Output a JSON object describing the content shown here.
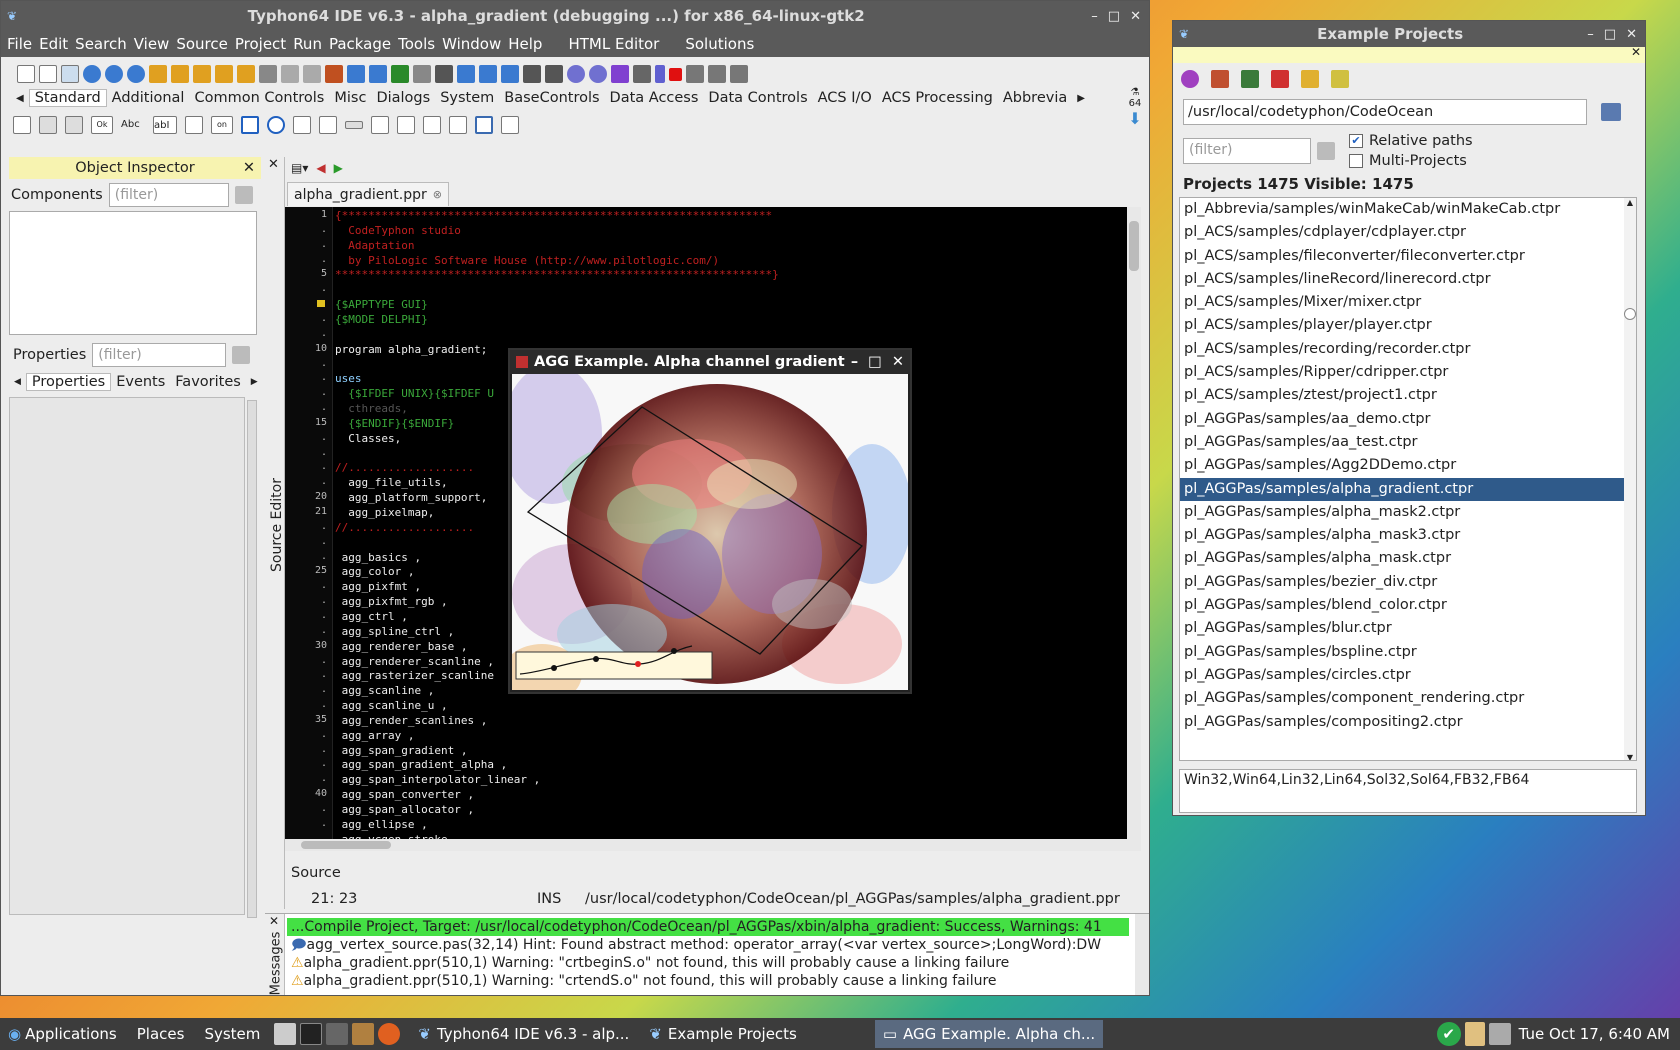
{
  "ide": {
    "title": "Typhon64 IDE v6.3 - alpha_gradient (debugging ...) for x86_64-linux-gtk2",
    "menu": [
      "File",
      "Edit",
      "Search",
      "View",
      "Source",
      "Project",
      "Run",
      "Package",
      "Tools",
      "Window",
      "Help",
      "HTML Editor",
      "Solutions"
    ],
    "palette_tabs": [
      "Standard",
      "Additional",
      "Common Controls",
      "Misc",
      "Dialogs",
      "System",
      "BaseControls",
      "Data Access",
      "Data Controls",
      "ACS I/O",
      "ACS Processing",
      "Abbrevia"
    ],
    "palette_badge": "64"
  },
  "inspector": {
    "title": "Object Inspector",
    "components_label": "Components",
    "filter_placeholder": "(filter)",
    "properties_label": "Properties",
    "tabs": [
      "Properties",
      "Events",
      "Favorites"
    ]
  },
  "editor": {
    "vertical_label": "Source Editor",
    "file_tab": "alpha_gradient.ppr",
    "lines": [
      {
        "n": "1",
        "t": "{*****************************************************************",
        "c": "#c02020"
      },
      {
        "n": ".",
        "t": "  CodeTyphon studio",
        "c": "#c02020"
      },
      {
        "n": ".",
        "t": "  Adaptation",
        "c": "#c02020"
      },
      {
        "n": ".",
        "t": "  by PiloLogic Software House (http://www.pilotlogic.com/)",
        "c": "#c02020"
      },
      {
        "n": "5",
        "t": "******************************************************************}",
        "c": "#c02020"
      },
      {
        "n": ".",
        "t": "",
        "c": "#eee"
      },
      {
        "n": ".",
        "t": "{$APPTYPE GUI}",
        "c": "#3aa83a"
      },
      {
        "n": ".",
        "t": "{$MODE DELPHI}",
        "c": "#3aa83a"
      },
      {
        "n": ".",
        "t": "",
        "c": "#eee"
      },
      {
        "n": "10",
        "t": "program alpha_gradient;",
        "c": "#eee"
      },
      {
        "n": ".",
        "t": "",
        "c": "#eee"
      },
      {
        "n": ".",
        "t": "uses",
        "c": "#8fd0ff"
      },
      {
        "n": ".",
        "t": "  {$IFDEF UNIX}{$IFDEF U",
        "c": "#3aa83a"
      },
      {
        "n": ".",
        "t": "  cthreads,",
        "c": "#555"
      },
      {
        "n": "15",
        "t": "  {$ENDIF}{$ENDIF}",
        "c": "#3aa83a"
      },
      {
        "n": ".",
        "t": "  Classes,",
        "c": "#eee"
      },
      {
        "n": ".",
        "t": "",
        "c": "#eee"
      },
      {
        "n": ".",
        "t": "//...................",
        "c": "#c02020"
      },
      {
        "n": ".",
        "t": "  agg_file_utils,",
        "c": "#eee"
      },
      {
        "n": "20",
        "t": "  agg_platform_support,",
        "c": "#eee"
      },
      {
        "n": "21",
        "t": "  agg_pixelmap,",
        "c": "#eee"
      },
      {
        "n": ".",
        "t": "//...................",
        "c": "#c02020"
      },
      {
        "n": ".",
        "t": "",
        "c": "#eee"
      },
      {
        "n": ".",
        "t": " agg_basics ,",
        "c": "#eee"
      },
      {
        "n": "25",
        "t": " agg_color ,",
        "c": "#eee"
      },
      {
        "n": ".",
        "t": " agg_pixfmt ,",
        "c": "#eee"
      },
      {
        "n": ".",
        "t": " agg_pixfmt_rgb ,",
        "c": "#eee"
      },
      {
        "n": ".",
        "t": " agg_ctrl ,",
        "c": "#eee"
      },
      {
        "n": ".",
        "t": " agg_spline_ctrl ,",
        "c": "#eee"
      },
      {
        "n": "30",
        "t": " agg_renderer_base ,",
        "c": "#eee"
      },
      {
        "n": ".",
        "t": " agg_renderer_scanline ,",
        "c": "#eee"
      },
      {
        "n": ".",
        "t": " agg_rasterizer_scanline",
        "c": "#eee"
      },
      {
        "n": ".",
        "t": " agg_scanline ,",
        "c": "#eee"
      },
      {
        "n": ".",
        "t": " agg_scanline_u ,",
        "c": "#eee"
      },
      {
        "n": "35",
        "t": " agg_render_scanlines ,",
        "c": "#eee"
      },
      {
        "n": ".",
        "t": " agg_array ,",
        "c": "#eee"
      },
      {
        "n": ".",
        "t": " agg_span_gradient ,",
        "c": "#eee"
      },
      {
        "n": ".",
        "t": " agg_span_gradient_alpha ,",
        "c": "#eee"
      },
      {
        "n": ".",
        "t": " agg_span_interpolator_linear ,",
        "c": "#eee"
      },
      {
        "n": "40",
        "t": " agg_span_converter ,",
        "c": "#eee"
      },
      {
        "n": ".",
        "t": " agg_span_allocator ,",
        "c": "#eee"
      },
      {
        "n": ".",
        "t": " agg_ellipse ,",
        "c": "#eee"
      },
      {
        "n": ".",
        "t": " agg_vcgen_stroke ,",
        "c": "#eee"
      }
    ],
    "source_tab": "Source",
    "status_pos": "21: 23",
    "status_mode": "INS",
    "status_path": "/usr/local/codetyphon/CodeOcean/pl_AGGPas/samples/alpha_gradient.ppr"
  },
  "messages": {
    "vertical_label": "Messages",
    "lines": [
      {
        "text": "...Compile Project, Target: /usr/local/codetyphon/CodeOcean/pl_AGGPas/xbin/alpha_gradient: Success, Warnings: 41",
        "kind": "success"
      },
      {
        "text": "agg_vertex_source.pas(32,14) Hint: Found abstract method: operator_array(<var vertex_source>;LongWord):DW",
        "kind": "hint"
      },
      {
        "text": "alpha_gradient.ppr(510,1) Warning: \"crtbeginS.o\" not found, this will probably cause a linking failure",
        "kind": "warning"
      },
      {
        "text": "alpha_gradient.ppr(510,1) Warning: \"crtendS.o\" not found, this will probably cause a linking failure",
        "kind": "warning"
      }
    ]
  },
  "agg": {
    "title": "AGG Example. Alpha channel gradient"
  },
  "projects": {
    "title": "Example Projects",
    "path": "/usr/local/codetyphon/CodeOcean",
    "filter_placeholder": "(filter)",
    "relative_paths": "Relative paths",
    "multi_projects": "Multi-Projects",
    "count": "Projects 1475  Visible: 1475",
    "items": [
      "pl_Abbrevia/samples/winMakeCab/winMakeCab.ctpr",
      "pl_ACS/samples/cdplayer/cdplayer.ctpr",
      "pl_ACS/samples/fileconverter/fileconverter.ctpr",
      "pl_ACS/samples/lineRecord/linerecord.ctpr",
      "pl_ACS/samples/Mixer/mixer.ctpr",
      "pl_ACS/samples/player/player.ctpr",
      "pl_ACS/samples/recording/recorder.ctpr",
      "pl_ACS/samples/Ripper/cdripper.ctpr",
      "pl_ACS/samples/ztest/project1.ctpr",
      "pl_AGGPas/samples/aa_demo.ctpr",
      "pl_AGGPas/samples/aa_test.ctpr",
      "pl_AGGPas/samples/Agg2DDemo.ctpr",
      "pl_AGGPas/samples/alpha_gradient.ctpr",
      "pl_AGGPas/samples/alpha_mask2.ctpr",
      "pl_AGGPas/samples/alpha_mask3.ctpr",
      "pl_AGGPas/samples/alpha_mask.ctpr",
      "pl_AGGPas/samples/bezier_div.ctpr",
      "pl_AGGPas/samples/blend_color.ctpr",
      "pl_AGGPas/samples/blur.ctpr",
      "pl_AGGPas/samples/bspline.ctpr",
      "pl_AGGPas/samples/circles.ctpr",
      "pl_AGGPas/samples/component_rendering.ctpr",
      "pl_AGGPas/samples/compositing2.ctpr"
    ],
    "selected_index": 12,
    "platforms": "Win32,Win64,Lin32,Lin64,Sol32,Sol64,FB32,FB64"
  },
  "taskbar": {
    "menus": [
      "Applications",
      "Places",
      "System"
    ],
    "windows": [
      "Typhon64 IDE v6.3 - alp...",
      "Example Projects",
      "AGG Example. Alpha ch..."
    ],
    "clock": "Tue Oct 17,  6:40 AM"
  }
}
